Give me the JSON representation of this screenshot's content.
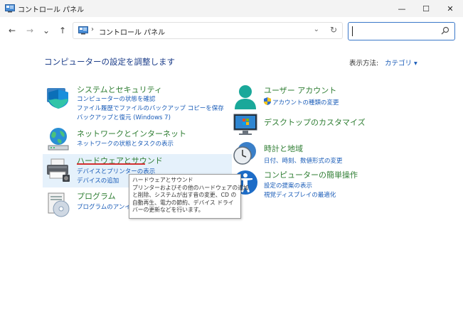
{
  "window": {
    "title": "コントロール パネル",
    "minimize": "—",
    "maximize": "☐",
    "close": "✕"
  },
  "nav": {
    "back": "←",
    "forward": "→",
    "recent": "⌄",
    "up": "↑"
  },
  "address": {
    "separator": "›",
    "text": "コントロール パネル",
    "dropdown": "⌄",
    "refresh": "↻"
  },
  "search": {
    "placeholder": "",
    "value": ""
  },
  "page": {
    "heading": "コンピューターの設定を調整します",
    "view_label": "表示方法:",
    "view_value": "カテゴリ ▾"
  },
  "categories": [
    {
      "title": "システムとセキュリティ",
      "links": [
        "コンピューターの状態を確認",
        "ファイル履歴でファイルのバックアップ コピーを保存",
        "バックアップと復元 (Windows 7)"
      ]
    },
    {
      "title": "ネットワークとインターネット",
      "links": [
        "ネットワークの状態とタスクの表示"
      ]
    },
    {
      "title": "ハードウェアとサウンド",
      "links": [
        "デバイスとプリンターの表示",
        "デバイスの追加"
      ]
    },
    {
      "title": "プログラム",
      "links": [
        "プログラムのアンインストール"
      ]
    },
    {
      "title": "ユーザー アカウント",
      "links": [
        "アカウントの種類の変更"
      ]
    },
    {
      "title": "デスクトップのカスタマイズ",
      "links": []
    },
    {
      "title": "時計と地域",
      "links": [
        "日付、時刻、数値形式の変更"
      ]
    },
    {
      "title": "コンピューターの簡単操作",
      "links": [
        "設定の提案の表示",
        "視覚ディスプレイの最適化"
      ]
    }
  ],
  "tooltip": {
    "lines": [
      "ハードウェアとサウンド",
      "プリンターおよびその他のハードウェアの追加",
      "と削除、システムが出す音の変更、CD の",
      "自動再生、電力の節約、デバイス ドライ",
      "バーの更新などを行います。"
    ]
  }
}
